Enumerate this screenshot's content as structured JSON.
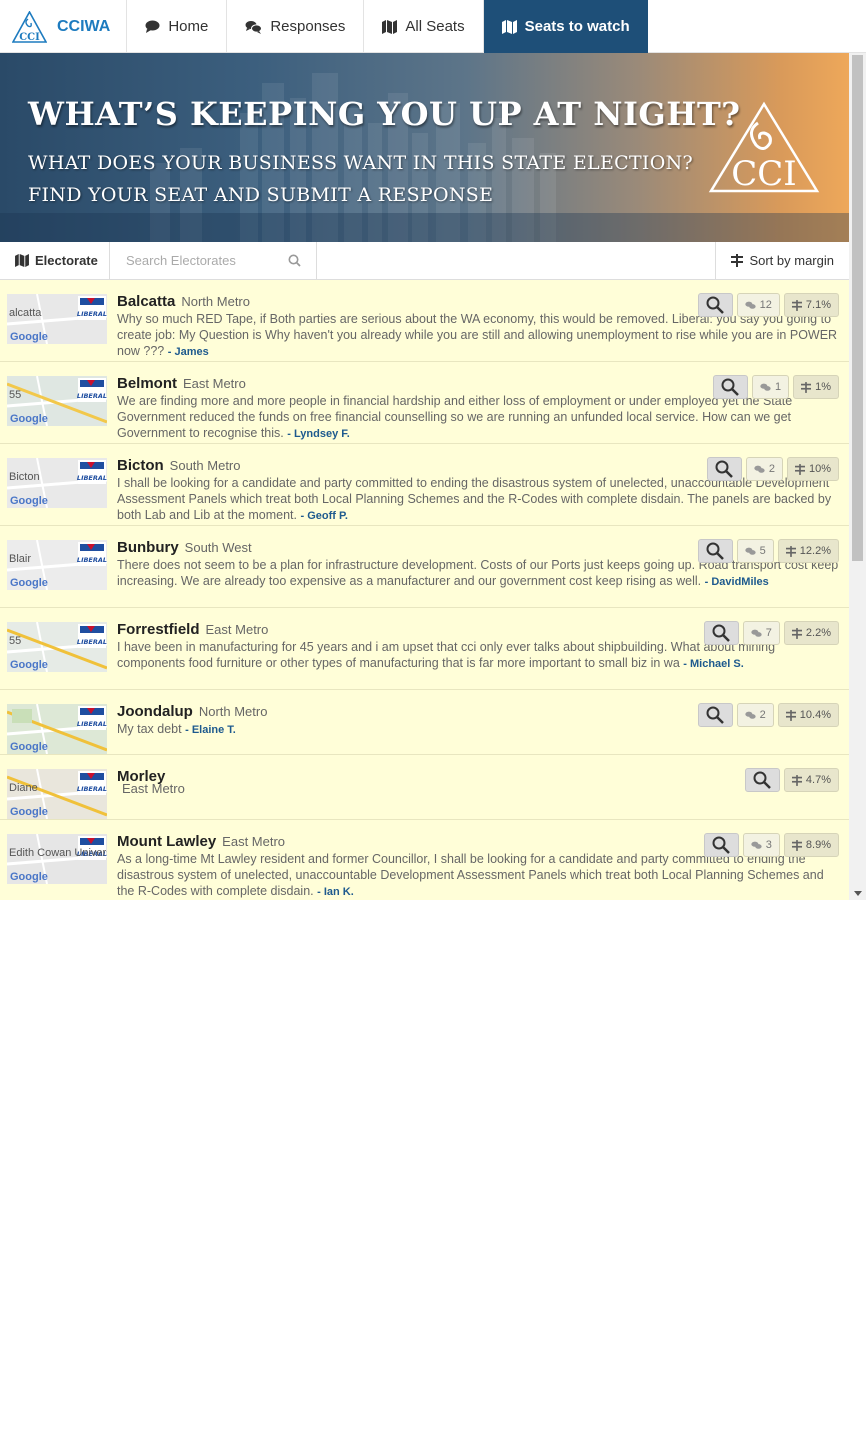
{
  "nav": {
    "brand": "CCIWA",
    "items": [
      {
        "label": "Home",
        "icon": "comment-icon"
      },
      {
        "label": "Responses",
        "icon": "comments-icon"
      },
      {
        "label": "All Seats",
        "icon": "map-icon"
      },
      {
        "label": "Seats to watch",
        "icon": "map-icon",
        "active": true
      }
    ]
  },
  "hero": {
    "title": "WHAT’S KEEPING YOU UP AT NIGHT?",
    "line1": "WHAT DOES YOUR BUSINESS WANT IN THIS STATE ELECTION?",
    "line2": "FIND YOUR SEAT AND SUBMIT A RESPONSE",
    "logo_text": "CCI"
  },
  "toolbar": {
    "electorate_label": "Electorate",
    "search_placeholder": "Search Electorates",
    "search_value": "",
    "sort_label": "Sort by margin"
  },
  "map_labels": {
    "google": "Google",
    "liberal": "LIBERAL"
  },
  "seats": [
    {
      "name": "Balcatta",
      "region": "North Metro",
      "comments": "12",
      "margin": "7.1%",
      "comment": "Why so much RED Tape, if Both parties are serious about the WA economy, this would be removed. Liberal: you say you going to create job: My Question is Why haven't you already while you are still and allowing unemployment to rise while you are in POWER now ???",
      "author": "James",
      "map_text": "alcatta"
    },
    {
      "name": "Belmont",
      "region": "East Metro",
      "comments": "1",
      "margin": "1%",
      "comment": "We are finding more and more people in financial hardship and either loss of employment or under employed yet the State Government reduced the funds on free financial counselling so we are running an unfunded local service. How can we get Government to recognise this.",
      "author": "Lyndsey F.",
      "map_text": "55"
    },
    {
      "name": "Bicton",
      "region": "South Metro",
      "comments": "2",
      "margin": "10%",
      "comment": "I shall be looking for a candidate and party committed to ending the disastrous system of unelected, unaccountable Development Assessment Panels which treat both Local Planning Schemes and the R-Codes with complete disdain. The panels are backed by both Lab and Lib at the moment.",
      "author": "Geoff P.",
      "map_text": "Bicton"
    },
    {
      "name": "Bunbury",
      "region": "South West",
      "comments": "5",
      "margin": "12.2%",
      "comment": "There does not seem to be a plan for infrastructure development. Costs of our Ports just keeps going up. Road transport cost keep increasing. We are already too expensive as a manufacturer and our government cost keep rising as well.",
      "author": "DavidMiles",
      "map_text": "Blair"
    },
    {
      "name": "Forrestfield",
      "region": "East Metro",
      "comments": "7",
      "margin": "2.2%",
      "comment": "I have been in manufacturing for 45 years and i am upset that cci only ever talks about shipbuilding. What about mining components food furniture or other types of manufacturing that is far more important to small biz in wa",
      "author": "Michael S.",
      "map_text": "55"
    },
    {
      "name": "Joondalup",
      "region": "North Metro",
      "comments": "2",
      "margin": "10.4%",
      "comment": "My tax debt",
      "author": "Elaine T.",
      "map_text": ""
    },
    {
      "name": "Morley",
      "region": "East Metro",
      "comments": "",
      "margin": "4.7%",
      "comment": "",
      "author": "",
      "map_text": "Diane"
    },
    {
      "name": "Mount Lawley",
      "region": "East Metro",
      "comments": "3",
      "margin": "8.9%",
      "comment": "As a long-time Mt Lawley resident and former Councillor, I shall be looking for a candidate and party committed to ending the disastrous system of unelected, unaccountable Development Assessment Panels which treat both Local Planning Schemes and the R-Codes with complete disdain.",
      "author": "Ian K.",
      "map_text": "Edith Cowan University"
    }
  ],
  "colors": {
    "nav_active_bg": "#1e4f78",
    "brand_blue": "#1d7bbf",
    "list_bg": "#fffed8",
    "author_blue": "#1e5a8e"
  }
}
